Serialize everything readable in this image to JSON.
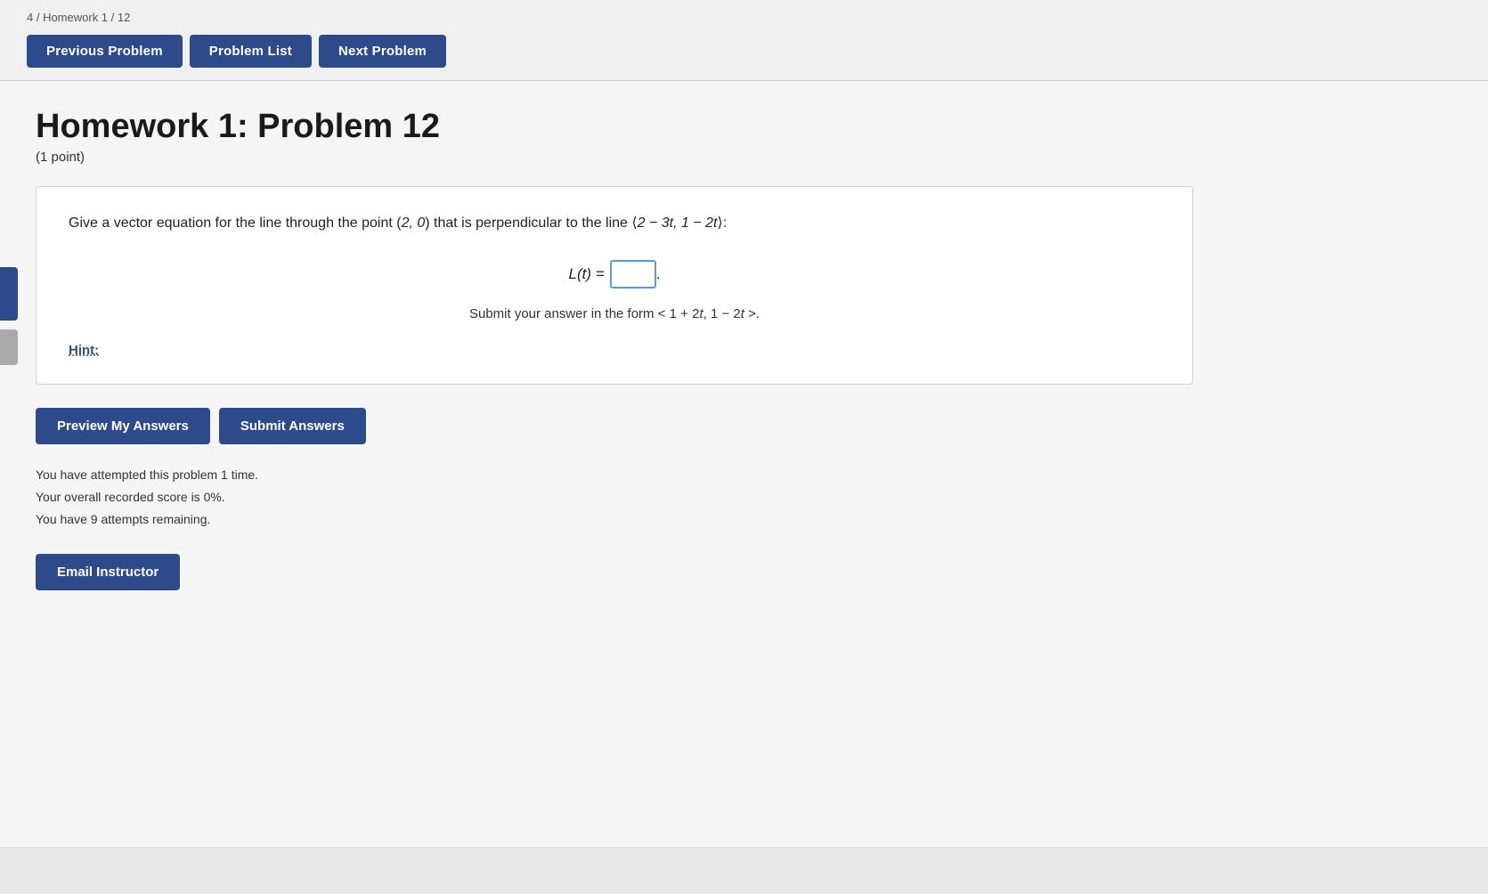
{
  "breadcrumb": {
    "text": "4 / Homework 1 / 12"
  },
  "nav": {
    "previous_label": "Previous Problem",
    "list_label": "Problem List",
    "next_label": "Next Problem"
  },
  "problem": {
    "title": "Homework 1: Problem 12",
    "points": "(1 point)",
    "statement": "Give a vector equation for the line through the point (2, 0) that is perpendicular to the line ⟨2 − 3t, 1 − 2t⟩:",
    "equation_prefix": "L(t) =",
    "answer_placeholder": "",
    "form_hint": "Submit your answer in the form < 1 + 2t, 1 − 2t >.",
    "hint_label": "Hint:"
  },
  "actions": {
    "preview_label": "Preview My Answers",
    "submit_label": "Submit Answers"
  },
  "attempts": {
    "line1": "You have attempted this problem 1 time.",
    "line2": "Your overall recorded score is 0%.",
    "line3": "You have 9 attempts remaining."
  },
  "email": {
    "label": "Email Instructor"
  }
}
